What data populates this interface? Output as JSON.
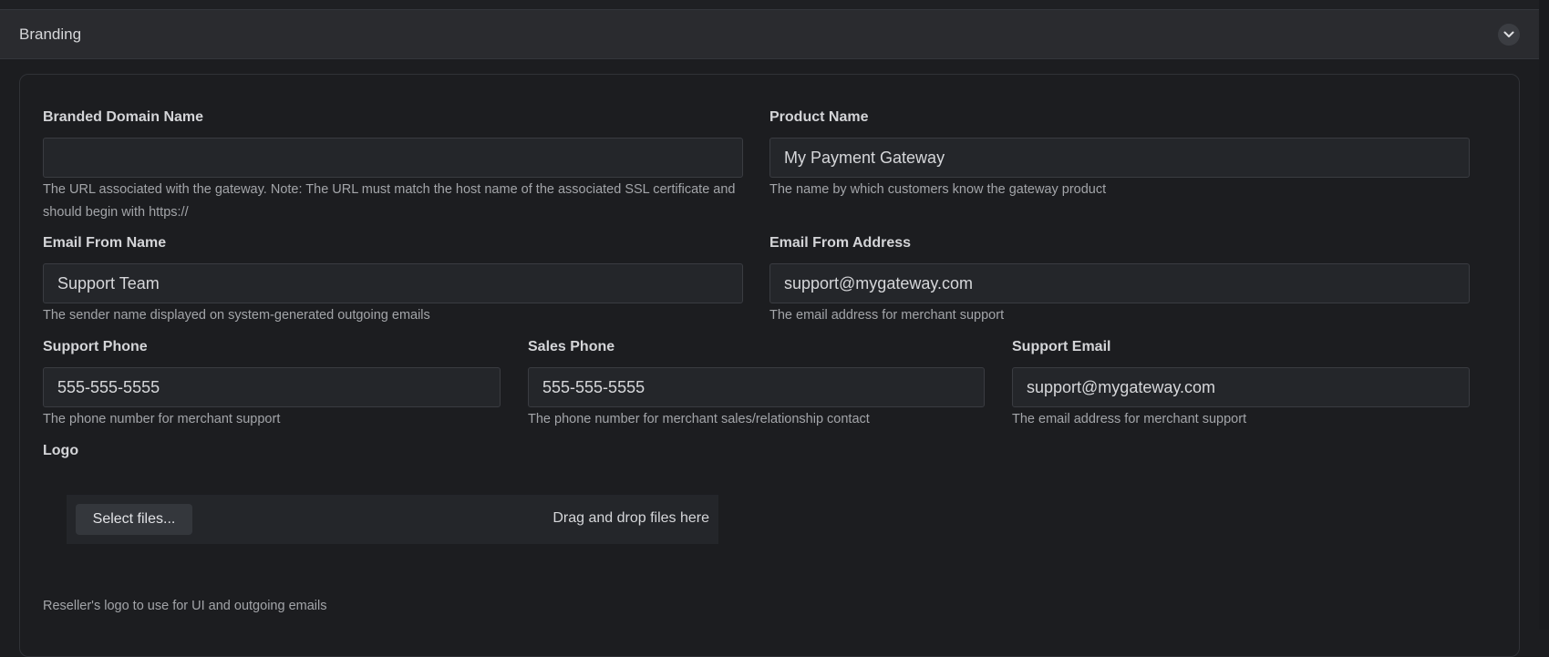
{
  "section": {
    "title": "Branding",
    "collapse_icon": "chevron-down-icon"
  },
  "fields": {
    "branded_domain": {
      "label": "Branded Domain Name",
      "value": "",
      "hint": "The URL associated with the gateway. Note: The URL must match the host name of the associated SSL certificate and should begin with https://"
    },
    "product_name": {
      "label": "Product Name",
      "value": "My Payment Gateway",
      "hint": "The name by which customers know the gateway product"
    },
    "email_from_name": {
      "label": "Email From Name",
      "value": "Support Team",
      "hint": "The sender name displayed on system-generated outgoing emails"
    },
    "email_from_address": {
      "label": "Email From Address",
      "value": "support@mygateway.com",
      "hint": "The email address for merchant support"
    },
    "support_phone": {
      "label": "Support Phone",
      "value": "555-555-5555",
      "hint": "The phone number for merchant support"
    },
    "sales_phone": {
      "label": "Sales Phone",
      "value": "555-555-5555",
      "hint": "The phone number for merchant sales/relationship contact"
    },
    "support_email": {
      "label": "Support Email",
      "value": "support@mygateway.com",
      "hint": "The email address for merchant support"
    },
    "logo": {
      "label": "Logo",
      "select_button": "Select files...",
      "drop_text": "Drag and drop files here",
      "hint": "Reseller's logo to use for UI and outgoing emails"
    }
  }
}
